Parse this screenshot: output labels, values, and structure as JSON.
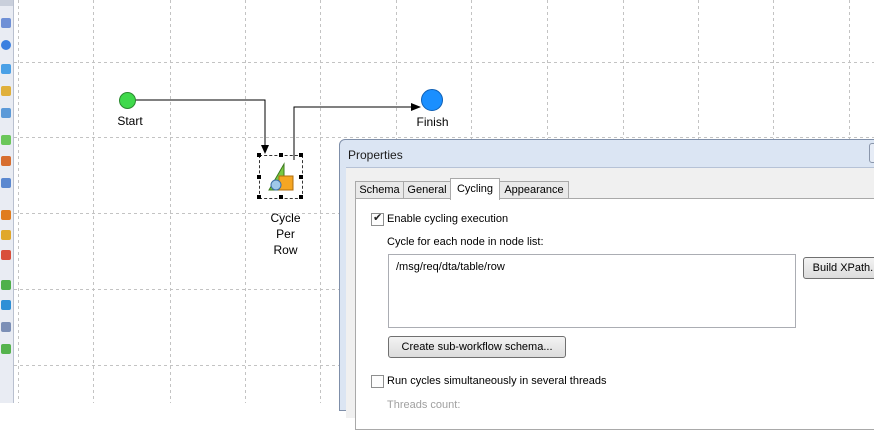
{
  "workflow": {
    "start_label": "Start",
    "finish_label": "Finish",
    "cycle_label": [
      "Cycle",
      "Per",
      "Row"
    ]
  },
  "colors": {
    "start_node": "#3fd94b",
    "finish_node": "#1a8fff",
    "dialog_title_bg": "#dbe5f3"
  },
  "properties": {
    "title": "Properties",
    "tabs": [
      {
        "label": "Schema"
      },
      {
        "label": "General"
      },
      {
        "label": "Cycling",
        "active": true
      },
      {
        "label": "Appearance"
      }
    ],
    "enable_cycling_label": "Enable cycling execution",
    "enable_cycling_checked": true,
    "node_list_label": "Cycle for each node in node list:",
    "node_list_value": "/msg/req/dta/table/row",
    "build_xpath_label": "Build XPath...",
    "create_subworkflow_label": "Create sub-workflow schema...",
    "run_parallel_label": "Run cycles simultaneously in several threads",
    "run_parallel_checked": false,
    "threads_count_label": "Threads count:"
  }
}
